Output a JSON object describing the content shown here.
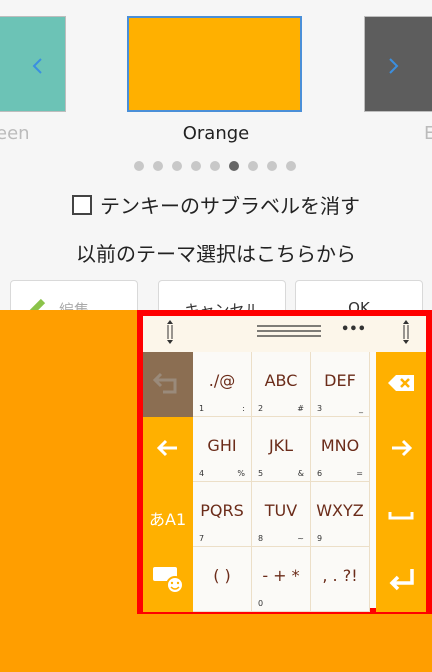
{
  "carousel": {
    "left_caption": "een",
    "center_caption": "Orange",
    "right_caption": "E",
    "colors": {
      "green": "#6cc3b6",
      "orange": "#ffb000",
      "dark": "#5d5d5d",
      "accent": "#4a8fd8"
    },
    "page_count": 9,
    "active_page": 6
  },
  "options": {
    "hide_sublabel": "テンキーのサブラベルを消す",
    "previous_theme": "以前のテーマ選択はこちらから"
  },
  "buttons": {
    "edit": "編集",
    "cancel": "キャンセル",
    "ok": "OK"
  },
  "keyboard": {
    "more": "•••",
    "keys": [
      {
        "main": "./@",
        "sub": "1",
        "sub2": ":"
      },
      {
        "main": "ABC",
        "sub": "2",
        "sub2": "#"
      },
      {
        "main": "DEF",
        "sub": "3",
        "sub2": "_"
      },
      {
        "main": "GHI",
        "sub": "4",
        "sub2": "%"
      },
      {
        "main": "JKL",
        "sub": "5",
        "sub2": "&"
      },
      {
        "main": "MNO",
        "sub": "6",
        "sub2": "="
      },
      {
        "main": "PQRS",
        "sub": "7",
        "sub2": ""
      },
      {
        "main": "TUV",
        "sub": "8",
        "sub2": "~"
      },
      {
        "main": "WXYZ",
        "sub": "9",
        "sub2": ""
      },
      {
        "main": "( )",
        "sub": "",
        "sub2": ""
      },
      {
        "main": "- + *",
        "sub": "0",
        "sub2": ""
      },
      {
        "main": ", . ?!",
        "sub": "",
        "sub2": ""
      }
    ],
    "mode_label": "あA1"
  }
}
